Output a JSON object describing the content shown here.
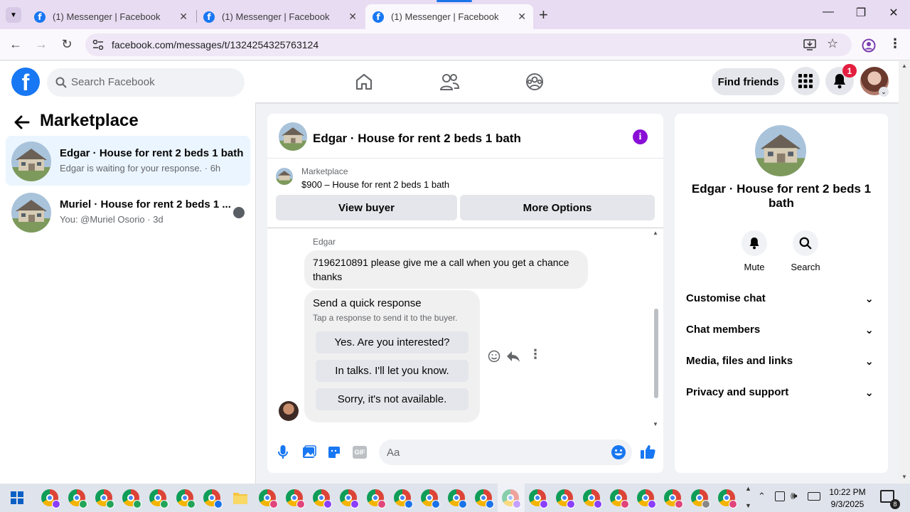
{
  "browser": {
    "tabs": [
      {
        "title": "(1) Messenger | Facebook",
        "active": false
      },
      {
        "title": "(1) Messenger | Facebook",
        "active": false
      },
      {
        "title": "(1) Messenger | Facebook",
        "active": true
      }
    ],
    "url": "facebook.com/messages/t/1324254325763124"
  },
  "header": {
    "search_placeholder": "Search Facebook",
    "find_friends": "Find friends",
    "notification_count": "1"
  },
  "left": {
    "title": "Marketplace",
    "conversations": [
      {
        "name": "Edgar · House for rent 2 beds 1 bath",
        "sub": "Edgar is waiting for your response. · 6h",
        "selected": true
      },
      {
        "name": "Muriel · House for rent 2 beds 1 ...",
        "sub": "You: @Muriel Osorio · 3d",
        "selected": false
      }
    ]
  },
  "chat": {
    "title": "Edgar · House for rent 2 beds 1 bath",
    "listing_label": "Marketplace",
    "listing_price": "$900 – House for rent 2 beds 1 bath",
    "view_buyer": "View buyer",
    "more_options": "More Options",
    "sender": "Edgar",
    "message": "7196210891 please give me a call when you get a chance thanks",
    "quick_title": "Send a quick response",
    "quick_sub": "Tap a response to send it to the buyer.",
    "quick_replies": [
      "Yes. Are you interested?",
      "In talks. I'll let you know.",
      "Sorry, it's not available."
    ],
    "composer_placeholder": "Aa"
  },
  "right": {
    "name": "Edgar · House for rent 2 beds 1 bath",
    "mute": "Mute",
    "search": "Search",
    "sections": [
      "Customise chat",
      "Chat members",
      "Media, files and links",
      "Privacy and support"
    ]
  },
  "taskbar": {
    "time": "10:22 PM",
    "date": "9/3/2025",
    "notif_count": "8"
  },
  "colors": {
    "fb_blue": "#1877f2",
    "accent_purple": "#8a0fd6",
    "badge_red": "#e41e3f"
  }
}
